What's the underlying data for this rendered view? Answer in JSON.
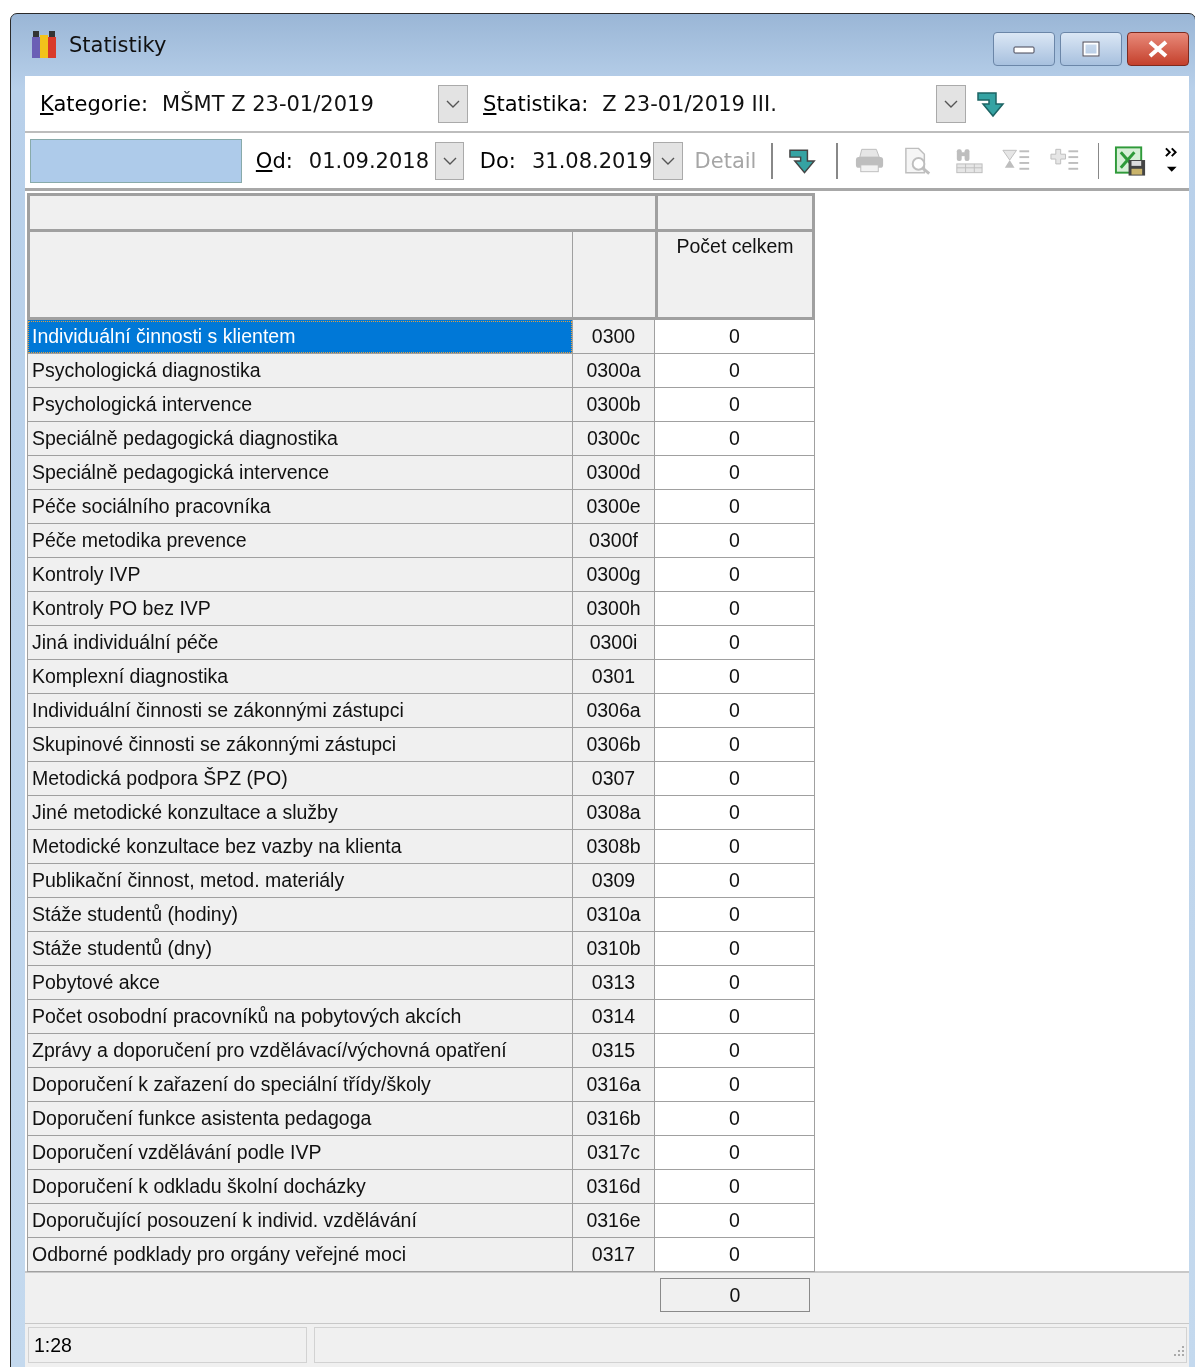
{
  "window": {
    "title": "Statistiky"
  },
  "filters": {
    "category": {
      "label": "Kategorie:",
      "mnemonic": true,
      "value": "MŠMT Z 23-01/2019"
    },
    "statistic": {
      "label": "Statistika:",
      "mnemonic": true,
      "value": "Z 23-01/2019 III."
    },
    "from": {
      "label": "Od:",
      "mnemonic": true,
      "value": "01.09.2018"
    },
    "to": {
      "label": "Do:",
      "mnemonic": false,
      "value": "31.08.2019"
    }
  },
  "toolbar": [
    {
      "kind": "detail",
      "label": "Detail",
      "disabled": true
    },
    {
      "kind": "separator"
    },
    {
      "kind": "go",
      "disabled": false
    },
    {
      "kind": "separator"
    },
    {
      "kind": "print",
      "disabled": true
    },
    {
      "kind": "preview",
      "disabled": true
    },
    {
      "kind": "find",
      "disabled": true
    },
    {
      "kind": "filter",
      "disabled": true
    },
    {
      "kind": "add",
      "disabled": true
    },
    {
      "kind": "separator"
    },
    {
      "kind": "export",
      "disabled": false
    },
    {
      "kind": "more",
      "disabled": false
    }
  ],
  "table": {
    "count_header": "Počet celkem",
    "rows": [
      {
        "name": "Individuální činnosti s klientem",
        "code": "0300",
        "count": "0",
        "selected": true
      },
      {
        "name": "Psychologická diagnostika",
        "code": "0300a",
        "count": "0",
        "selected": false
      },
      {
        "name": "Psychologická intervence",
        "code": "0300b",
        "count": "0",
        "selected": false
      },
      {
        "name": "Speciálně pedagogická diagnostika",
        "code": "0300c",
        "count": "0",
        "selected": false
      },
      {
        "name": "Speciálně pedagogická intervence",
        "code": "0300d",
        "count": "0",
        "selected": false
      },
      {
        "name": "Péče sociálního pracovníka",
        "code": "0300e",
        "count": "0",
        "selected": false
      },
      {
        "name": "Péče metodika prevence",
        "code": "0300f",
        "count": "0",
        "selected": false
      },
      {
        "name": "Kontroly IVP",
        "code": "0300g",
        "count": "0",
        "selected": false
      },
      {
        "name": "Kontroly PO bez IVP",
        "code": "0300h",
        "count": "0",
        "selected": false
      },
      {
        "name": "Jiná individuální péče",
        "code": "0300i",
        "count": "0",
        "selected": false
      },
      {
        "name": "Komplexní diagnostika",
        "code": "0301",
        "count": "0",
        "selected": false
      },
      {
        "name": "Individuální činnosti se zákonnými zástupci",
        "code": "0306a",
        "count": "0",
        "selected": false
      },
      {
        "name": "Skupinové činnosti se zákonnými zástupci",
        "code": "0306b",
        "count": "0",
        "selected": false
      },
      {
        "name": "Metodická podpora ŠPZ (PO)",
        "code": "0307",
        "count": "0",
        "selected": false
      },
      {
        "name": "Jiné metodické konzultace a služby",
        "code": "0308a",
        "count": "0",
        "selected": false
      },
      {
        "name": "Metodické konzultace bez vazby na klienta",
        "code": "0308b",
        "count": "0",
        "selected": false
      },
      {
        "name": "Publikační činnost, metod. materiály",
        "code": "0309",
        "count": "0",
        "selected": false
      },
      {
        "name": "Stáže studentů (hodiny)",
        "code": "0310a",
        "count": "0",
        "selected": false
      },
      {
        "name": "Stáže studentů (dny)",
        "code": "0310b",
        "count": "0",
        "selected": false
      },
      {
        "name": "Pobytové akce",
        "code": "0313",
        "count": "0",
        "selected": false
      },
      {
        "name": "Počet osobodní pracovníků na pobytových akcích",
        "code": "0314",
        "count": "0",
        "selected": false
      },
      {
        "name": "Zprávy a doporučení pro vzdělávací/výchovná opatření",
        "code": "0315",
        "count": "0",
        "selected": false
      },
      {
        "name": "Doporučení k zařazení do speciální třídy/školy",
        "code": "0316a",
        "count": "0",
        "selected": false
      },
      {
        "name": "Doporučení funkce asistenta pedagoga",
        "code": "0316b",
        "count": "0",
        "selected": false
      },
      {
        "name": "Doporučení vzdělávání podle IVP",
        "code": "0317c",
        "count": "0",
        "selected": false
      },
      {
        "name": "Doporučení k odkladu školní docházky",
        "code": "0316d",
        "count": "0",
        "selected": false
      },
      {
        "name": "Doporučující posouzení k individ. vzdělávání",
        "code": "0316e",
        "count": "0",
        "selected": false
      },
      {
        "name": "Odborné podklady pro orgány veřejné moci",
        "code": "0317",
        "count": "0",
        "selected": false
      }
    ],
    "total": "0"
  },
  "status_bar": {
    "position": "1:28"
  }
}
